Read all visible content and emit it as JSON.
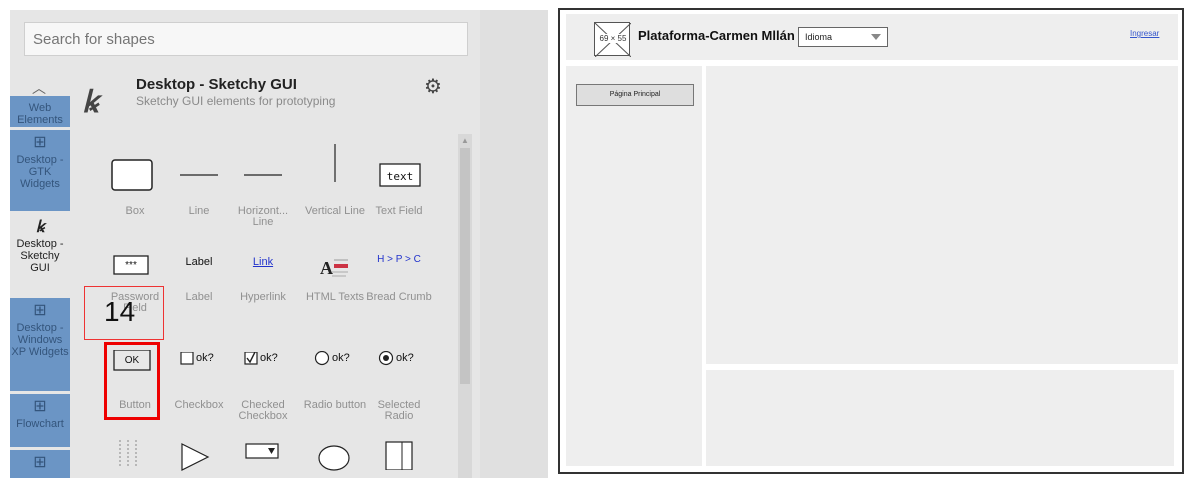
{
  "search": {
    "placeholder": "Search for shapes"
  },
  "rail": {
    "items": [
      {
        "label": "Web Elements",
        "icon": "grid-icon"
      },
      {
        "label": "Desktop - GTK Widgets",
        "icon": "grid-icon"
      },
      {
        "label": "Desktop - Sketchy GUI",
        "icon": "sketch-logo-icon"
      },
      {
        "label": "Desktop - Windows XP Widgets",
        "icon": "grid-icon"
      },
      {
        "label": "Flowchart",
        "icon": "grid-icon"
      }
    ]
  },
  "library": {
    "title": "Desktop - Sketchy GUI",
    "subtitle": "Sketchy GUI elements for prototyping",
    "shapes": [
      {
        "label": "Box"
      },
      {
        "label": "Line"
      },
      {
        "label": "Horizont... Line"
      },
      {
        "label": "Vertical Line"
      },
      {
        "label": "Text Field",
        "icon_text": "text"
      },
      {
        "label": "Password Field",
        "icon_text": "***"
      },
      {
        "label": "Label",
        "icon_text": "Label"
      },
      {
        "label": "Hyperlink",
        "icon_text": "Link"
      },
      {
        "label": "HTML Texts"
      },
      {
        "label": "Bread Crumb",
        "icon_text": "H > P > C"
      },
      {
        "label": "Button",
        "icon_text": "OK"
      },
      {
        "label": "Checkbox",
        "icon_text": "ok?"
      },
      {
        "label": "Checked Checkbox",
        "icon_text": "ok?"
      },
      {
        "label": "Radio button",
        "icon_text": "ok?"
      },
      {
        "label": "Selected Radio",
        "icon_text": "ok?"
      }
    ]
  },
  "annotation": {
    "number": "14"
  },
  "canvas": {
    "image_placeholder": "69 × 55",
    "site_title": "Plataforma-Carmen Mllán",
    "language_select": "Idioma",
    "login_link": "Ingresar",
    "nav_button": "Página Principal"
  },
  "colors": {
    "rail_tab": "#6b95c5",
    "annotation_red": "#ee0000",
    "link": "#3355cc"
  }
}
